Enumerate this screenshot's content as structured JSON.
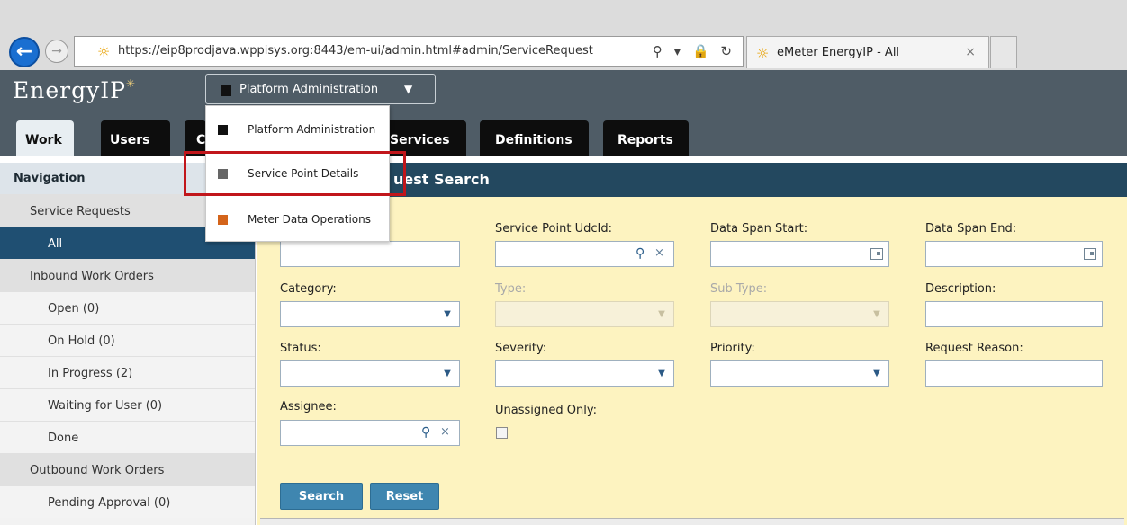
{
  "browser": {
    "url": "https://eip8prodjava.wppisys.org:8443/em-ui/admin.html#admin/ServiceRequest",
    "tab_title": "eMeter EnergyIP - All",
    "tools": "⚲ ▾ 🔒 ↻"
  },
  "app": {
    "logo": "EnergyIP",
    "app_selector": "Platform Administration",
    "tabs": [
      "Work",
      "Users",
      "C",
      "Services",
      "Definitions",
      "Reports"
    ]
  },
  "menu": {
    "items": [
      {
        "label": "Platform Administration",
        "color": "#111111"
      },
      {
        "label": "Service Point Details",
        "color": "#666666"
      },
      {
        "label": "Meter Data Operations",
        "color": "#d4641a"
      }
    ]
  },
  "sidebar": {
    "heading": "Navigation",
    "items": [
      {
        "label": "Service Requests"
      },
      {
        "label": "All"
      },
      {
        "label": "Inbound Work Orders"
      },
      {
        "label": "Open (0)"
      },
      {
        "label": "On Hold (0)"
      },
      {
        "label": "In Progress (2)"
      },
      {
        "label": "Waiting for User (0)"
      },
      {
        "label": "Done"
      },
      {
        "label": "Outbound Work Orders"
      },
      {
        "label": "Pending Approval (0)"
      }
    ]
  },
  "content": {
    "title": "uest Search",
    "labels": {
      "service_point": "Service Point UdcId:",
      "data_span_start": "Data Span Start:",
      "data_span_end": "Data Span End:",
      "category": "Category:",
      "type": "Type:",
      "sub_type": "Sub Type:",
      "description": "Description:",
      "status": "Status:",
      "severity": "Severity:",
      "priority": "Priority:",
      "request_reason": "Request Reason:",
      "assignee": "Assignee:",
      "unassigned_only": "Unassigned Only:"
    },
    "buttons": {
      "search": "Search",
      "reset": "Reset"
    }
  },
  "colors": {
    "header": "#4f5c66",
    "content_bg": "#fdf3c0",
    "title_bar": "#23485f",
    "highlight": "#c1161b"
  }
}
